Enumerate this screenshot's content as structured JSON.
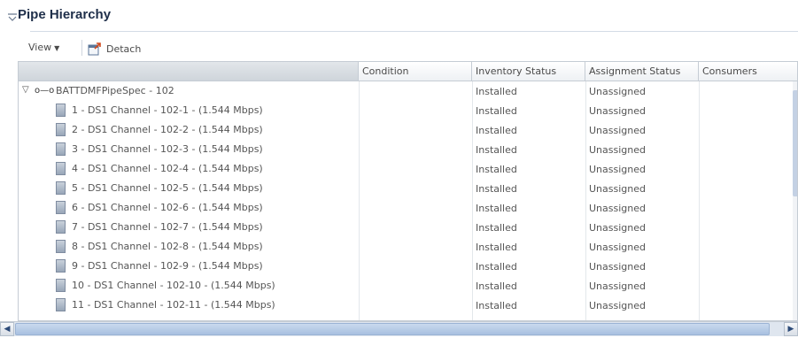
{
  "header": {
    "title": "Pipe Hierarchy"
  },
  "toolbar": {
    "view_label": "View",
    "view_caret": "▼",
    "detach_label": "Detach"
  },
  "table": {
    "columns": [
      "",
      "Condition",
      "Inventory Status",
      "Assignment Status",
      "Consumers"
    ],
    "root": {
      "expand_glyph": "▽",
      "pipe_glyph": "o—o",
      "label": "BATTDMFPipeSpec - 102",
      "condition": "",
      "inventory_status": "Installed",
      "assignment_status": "Unassigned",
      "consumers": ""
    },
    "children": [
      {
        "label": "1 - DS1 Channel - 102-1 - (1.544 Mbps)",
        "inventory_status": "Installed",
        "assignment_status": "Unassigned"
      },
      {
        "label": "2 - DS1 Channel - 102-2 - (1.544 Mbps)",
        "inventory_status": "Installed",
        "assignment_status": "Unassigned"
      },
      {
        "label": "3 - DS1 Channel - 102-3 - (1.544 Mbps)",
        "inventory_status": "Installed",
        "assignment_status": "Unassigned"
      },
      {
        "label": "4 - DS1 Channel - 102-4 - (1.544 Mbps)",
        "inventory_status": "Installed",
        "assignment_status": "Unassigned"
      },
      {
        "label": "5 - DS1 Channel - 102-5 - (1.544 Mbps)",
        "inventory_status": "Installed",
        "assignment_status": "Unassigned"
      },
      {
        "label": "6 - DS1 Channel - 102-6 - (1.544 Mbps)",
        "inventory_status": "Installed",
        "assignment_status": "Unassigned"
      },
      {
        "label": "7 - DS1 Channel - 102-7 - (1.544 Mbps)",
        "inventory_status": "Installed",
        "assignment_status": "Unassigned"
      },
      {
        "label": "8 - DS1 Channel - 102-8 - (1.544 Mbps)",
        "inventory_status": "Installed",
        "assignment_status": "Unassigned"
      },
      {
        "label": "9 - DS1 Channel - 102-9 - (1.544 Mbps)",
        "inventory_status": "Installed",
        "assignment_status": "Unassigned"
      },
      {
        "label": "10 - DS1 Channel - 102-10 - (1.544 Mbps)",
        "inventory_status": "Installed",
        "assignment_status": "Unassigned"
      },
      {
        "label": "11 - DS1 Channel - 102-11 - (1.544 Mbps)",
        "inventory_status": "Installed",
        "assignment_status": "Unassigned"
      }
    ]
  },
  "scrollbar": {
    "left_arrow": "◀",
    "right_arrow": "▶"
  },
  "colors": {
    "title": "#1f2f4a",
    "header_bg_first_col": "#cfd5db",
    "scroll_thumb": "#a8c0e0"
  }
}
